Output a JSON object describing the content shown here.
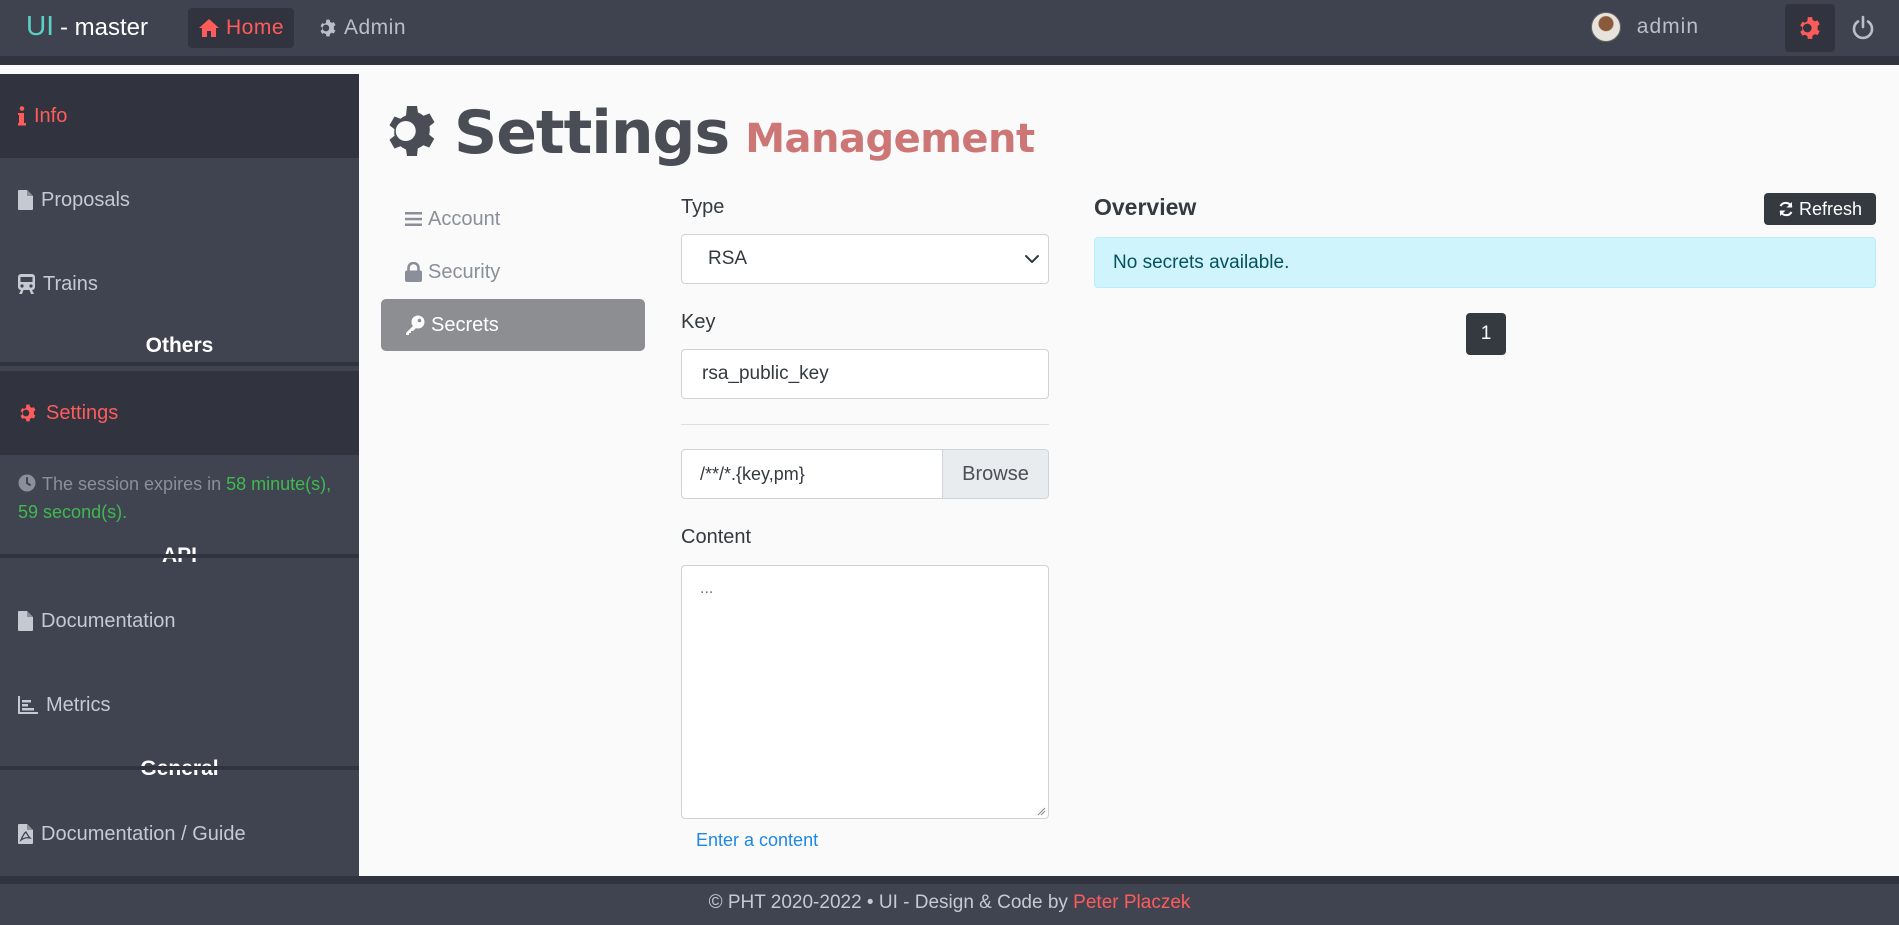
{
  "topbar": {
    "brand": "UI",
    "brand_suffix": "- master",
    "nav": [
      {
        "label": "Home",
        "icon": "home-icon"
      },
      {
        "label": "Admin",
        "icon": "gear-icon"
      }
    ],
    "user_name": "admin"
  },
  "sidebar": {
    "items": [
      {
        "label": "Info",
        "icon": "info-icon"
      },
      {
        "label": "Proposals",
        "icon": "file-icon"
      },
      {
        "label": "Trains",
        "icon": "train-icon"
      },
      {
        "label": "Settings",
        "icon": "gear-icon"
      },
      {
        "label": "Documentation",
        "icon": "file-icon"
      },
      {
        "label": "Metrics",
        "icon": "chart-icon"
      },
      {
        "label": "Documentation / Guide",
        "icon": "pdf-icon"
      }
    ],
    "headings": {
      "others": "Others",
      "api": "API",
      "general": "General"
    },
    "session": {
      "prefix": "The session expires in",
      "minutes": "58",
      "minutes_unit": "minute(s),",
      "seconds": "59",
      "seconds_unit": "second(s)."
    }
  },
  "main": {
    "title": "Settings",
    "subtitle": "Management",
    "subnav": [
      {
        "label": "Account",
        "icon": "list-icon"
      },
      {
        "label": "Security",
        "icon": "lock-icon"
      },
      {
        "label": "Secrets",
        "icon": "key-icon"
      }
    ],
    "form": {
      "type_label": "Type",
      "type_value": "RSA",
      "key_label": "Key",
      "key_value": "rsa_public_key",
      "file_pattern": "/**/*.{key,pm}",
      "browse_label": "Browse",
      "content_label": "Content",
      "content_placeholder": "...",
      "content_hint": "Enter a content"
    },
    "overview": {
      "title": "Overview",
      "refresh_label": "Refresh",
      "empty_message": "No secrets available.",
      "page": "1"
    }
  },
  "footer": {
    "text": "© PHT 2020-2022 • UI - Design & Code by",
    "author": "Peter Placzek"
  },
  "colors": {
    "accent": "#ff5b5b",
    "brand": "#5ad1c4",
    "navbar": "#3f4350",
    "success": "#3fb950"
  }
}
